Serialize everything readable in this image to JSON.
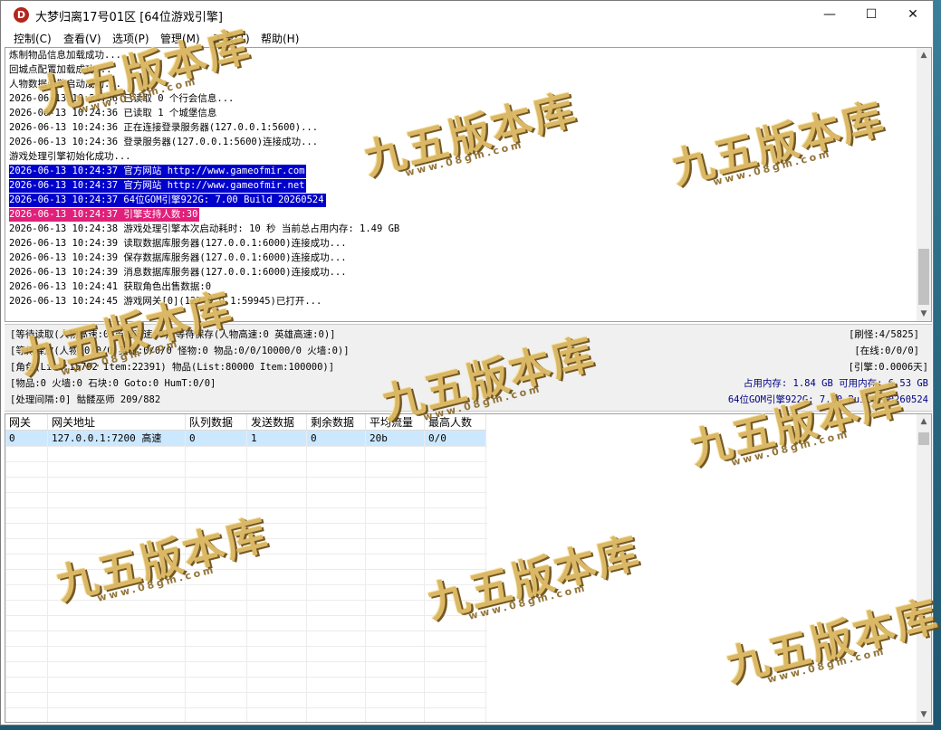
{
  "window": {
    "title": "大梦归离17号01区 [64位游戏引擎]",
    "icon_letter": "D",
    "controls": {
      "minimize": "—",
      "maximize": "☐",
      "close": "✕"
    }
  },
  "menu": [
    "控制(C)",
    "查看(V)",
    "选项(P)",
    "管理(M)",
    "工具(T)",
    "帮助(H)"
  ],
  "log": [
    {
      "text": "炼制物品信息加载成功...",
      "hl": ""
    },
    {
      "text": "回城点配置加载成功...",
      "hl": ""
    },
    {
      "text": "人物数据引擎启动成功...",
      "hl": ""
    },
    {
      "text": "2026-06-13 10:24:36 已读取 0 个行会信息...",
      "hl": ""
    },
    {
      "text": "2026-06-13 10:24:36 已读取 1 个城堡信息",
      "hl": ""
    },
    {
      "text": "2026-06-13 10:24:36 正在连接登录服务器(127.0.0.1:5600)...",
      "hl": ""
    },
    {
      "text": "2026-06-13 10:24:36 登录服务器(127.0.0.1:5600)连接成功...",
      "hl": ""
    },
    {
      "text": "游戏处理引擎初始化成功...",
      "hl": ""
    },
    {
      "text": "2026-06-13 10:24:37 官方网站 http://www.gameofmir.com",
      "hl": "blue"
    },
    {
      "text": "2026-06-13 10:24:37 官方网站 http://www.gameofmir.net",
      "hl": "blue"
    },
    {
      "text": "2026-06-13 10:24:37 64位GOM引擎922G: 7.00 Build 20260524",
      "hl": "blue"
    },
    {
      "text": "2026-06-13 10:24:37 引擎支持人数:30",
      "hl": "pink"
    },
    {
      "text": "2026-06-13 10:24:38 游戏处理引擎本次启动耗时: 10 秒 当前总占用内存: 1.49 GB",
      "hl": ""
    },
    {
      "text": "2026-06-13 10:24:39 读取数据库服务器(127.0.0.1:6000)连接成功...",
      "hl": ""
    },
    {
      "text": "2026-06-13 10:24:39 保存数据库服务器(127.0.0.1:6000)连接成功...",
      "hl": ""
    },
    {
      "text": "2026-06-13 10:24:39 消息数据库服务器(127.0.0.1:6000)连接成功...",
      "hl": ""
    },
    {
      "text": "2026-06-13 10:24:41 获取角色出售数据:0",
      "hl": ""
    },
    {
      "text": "2026-06-13 10:24:45 游戏网关[0](127.0.0.1:59945)已打开...",
      "hl": ""
    }
  ],
  "status": {
    "left": [
      "[等待读取(人物高速:0 英雄高速:0) 等待保存(人物高速:0 英雄高速:0)]",
      "[等待释放(人物:0/0/0 英雄:0/0/0 怪物:0 物品:0/0/10000/0 火墙:0)]",
      "[角色(List:15792 Item:22391) 物品(List:80000 Item:100000)]",
      "[物品:0 火墙:0 石块:0 Goto:0 HumT:0/0]",
      "[处理间隔:0] 骷髅巫师 209/882"
    ],
    "right": [
      "[刷怪:4/5825]",
      "[在线:0/0/0]",
      "[引擎:0.0006天]",
      "占用内存: 1.84 GB 可用内存: 6.53 GB",
      "64位GOM引擎922G: 7.00 Build 20260524"
    ]
  },
  "gateway_table": {
    "columns": [
      "网关",
      "网关地址",
      "队列数据",
      "发送数据",
      "剩余数据",
      "平均流量",
      "最高人数"
    ],
    "rows": [
      [
        "0",
        "127.0.0.1:7200 高速",
        "0",
        "1",
        "0",
        "20b",
        "0/0"
      ]
    ]
  },
  "watermark": {
    "text": "九五版本库",
    "url": "www.08gm.com"
  },
  "colors": {
    "log_blue_bg": "#0000cc",
    "log_pink_bg": "#e0207a",
    "selected_row": "#cce8ff",
    "status_blue": "#000080"
  }
}
